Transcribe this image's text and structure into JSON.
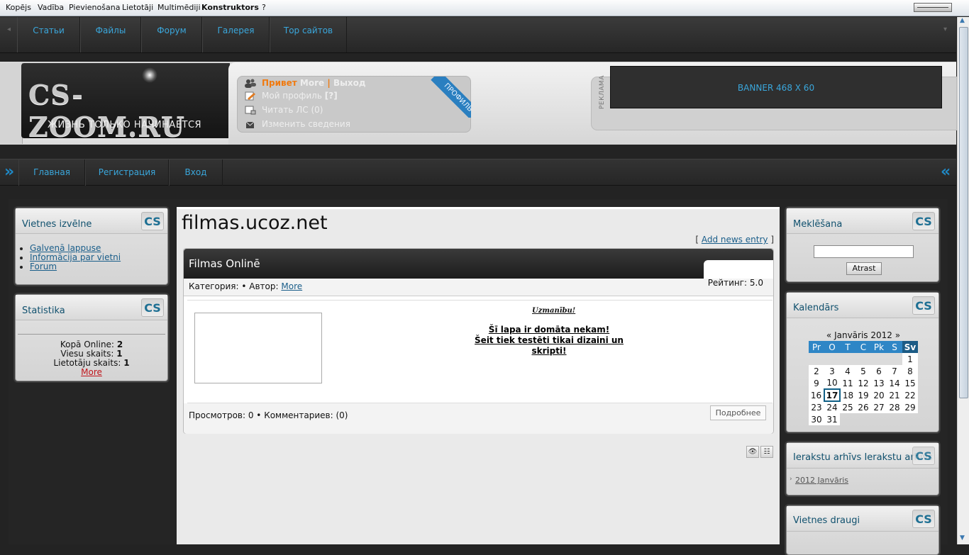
{
  "adminbar": {
    "items": [
      "Kopējs",
      "Vadība",
      "Pievienošana",
      "Lietotāji",
      "Multimēdiji",
      "Konstruktors",
      "?"
    ]
  },
  "topnav": {
    "items": [
      "Статьи",
      "Файлы",
      "Форум",
      "Галерея",
      "Тор сайтов"
    ]
  },
  "header": {
    "logo": "CS-ZOOM.RU",
    "slogan": "ЖИЗНЬ ТОЛЬКО НАЧИНАЕТСЯ",
    "greet": "Привет",
    "user": "More",
    "sep": "|",
    "logout": "Выход",
    "my_profile": "Мой профиль",
    "profile_q": "[?]",
    "read_pm": "Читать ЛС (0)",
    "edit_info": "Изменить сведения",
    "ribbon": "ПРОФИЛЬ",
    "ad_label": "РЕКЛАМА",
    "banner": "BANNER 468 X 60"
  },
  "subnav": {
    "items": [
      "Главная",
      "Регистрация",
      "Вход"
    ]
  },
  "left": {
    "menu_title": "Vietnes izvēlne",
    "menu_items": [
      "Galvenā lappuse",
      "Informācija par vietni",
      "Forum"
    ],
    "stats_title": "Statistika",
    "online_label": "Kopā Online:",
    "online_value": "2",
    "guests_label": "Viesu skaits:",
    "guests_value": "1",
    "users_label": "Lietotāju skaits:",
    "users_value": "1",
    "more": "More",
    "cs": "CS"
  },
  "center": {
    "site_title": "filmas.ucoz.net",
    "add_open": "[",
    "add_link": "Add news entry",
    "add_close": "]",
    "entry_title": "Filmas Onlinē",
    "category": "Категория: • Автор:",
    "author": "More",
    "rating": "Рейтинг: 5.0",
    "warn_head": "Uzmanību!",
    "warn_line1": "Šī lapa ir domāta nekam!",
    "warn_line2": "Šeit tiek testēti tikai dizaini un skripti!",
    "stats": "Просмотров: 0 • Комментариев: (0)",
    "more_button": "Подробнее"
  },
  "right": {
    "search_title": "Meklēšana",
    "search_button": "Atrast",
    "calendar_title": "Kalendārs",
    "cal_prev": "«",
    "cal_month": "Janvāris 2012",
    "cal_next": "»",
    "cal_days": [
      "Pr",
      "O",
      "T",
      "C",
      "Pk",
      "S",
      "Sv"
    ],
    "cal_weeks": [
      [
        "",
        "",
        "",
        "",
        "",
        "",
        "1"
      ],
      [
        "2",
        "3",
        "4",
        "5",
        "6",
        "7",
        "8"
      ],
      [
        "9",
        "10",
        "11",
        "12",
        "13",
        "14",
        "15"
      ],
      [
        "16",
        "17",
        "18",
        "19",
        "20",
        "21",
        "22"
      ],
      [
        "23",
        "24",
        "25",
        "26",
        "27",
        "28",
        "29"
      ],
      [
        "30",
        "31",
        "",
        "",
        "",
        "",
        ""
      ]
    ],
    "cal_today": "17",
    "archive_title": "Ierakstu arhīvs",
    "archive_item": "2012 Janvāris",
    "friends_title": "Vietnes draugi"
  },
  "colors": {
    "accent": "#3aa7dc",
    "title_blue": "#11516e",
    "calendar_head": "#2e86c6"
  }
}
